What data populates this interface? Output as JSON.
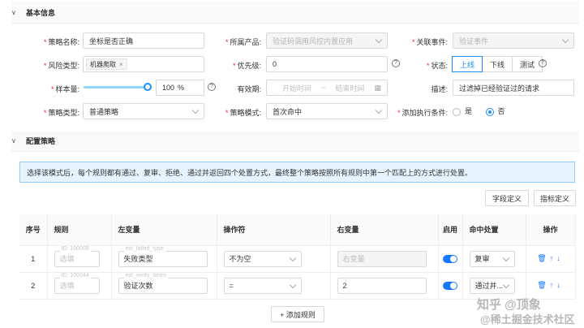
{
  "section1": {
    "title": "基本信息"
  },
  "section2": {
    "title": "配置策略"
  },
  "form": {
    "name_label": "策略名称:",
    "name_value": "坐标是否正确",
    "product_label": "所属产品:",
    "product_value": "验证码调用风控内置应用",
    "event_label": "关联事件:",
    "event_value": "验证事件",
    "risk_label": "风险类型:",
    "risk_tag": "机器爬取",
    "risk_tag_close": "×",
    "priority_label": "优先级:",
    "priority_value": "0",
    "status_label": "状态:",
    "status_options": [
      "上线",
      "下线",
      "测试"
    ],
    "sample_label": "样本量:",
    "sample_value": "100",
    "sample_unit": "%",
    "sample_level": 1.0,
    "validity_label": "有效期:",
    "start_placeholder": "开始时间",
    "range_sep": "~",
    "end_placeholder": "结束时间",
    "desc_label": "描述:",
    "desc_value": "过滤掉已经验证过的请求",
    "type_label": "策略类型:",
    "type_value": "普通策略",
    "mode_label": "策略模式:",
    "mode_value": "首次命中",
    "cond_label": "添加执行条件:",
    "cond_yes": "是",
    "cond_no": "否",
    "help_icon": "?"
  },
  "info_text": "选择该模式后，每个规则都有通过、复审、拒绝、通过并返回四个处置方式，最终整个策略按照所有规则中第一个匹配上的方式进行处置。",
  "buttons": {
    "field_def": "字段定义",
    "metric_def": "指标定义",
    "add_rule": "+ 添加规则"
  },
  "table": {
    "headers": [
      "序号",
      "规则",
      "左变量",
      "操作符",
      "右变量",
      "启用",
      "命中处置",
      "操作"
    ],
    "rows": [
      {
        "index": "1",
        "rule_id": "ID: 100008",
        "rule_placeholder": "选填",
        "left_hint": "ext_failed_type",
        "left_value": "失败类型",
        "operator": "不为空",
        "right_placeholder": "右变量",
        "right_value": "",
        "enabled": true,
        "action": "复审"
      },
      {
        "index": "2",
        "rule_id": "ID: 100044",
        "rule_placeholder": "选填",
        "left_hint": "ext_verify_times",
        "left_value": "验证次数",
        "operator": "=",
        "right_placeholder": "",
        "right_value": "2",
        "enabled": true,
        "action": "通过并..."
      }
    ],
    "op_icons": [
      "trash-icon",
      "arrow-up-icon",
      "arrow-down-icon"
    ]
  },
  "watermark": {
    "line1": "知乎 @顶象",
    "line2": "@稀土掘金技术社区"
  }
}
